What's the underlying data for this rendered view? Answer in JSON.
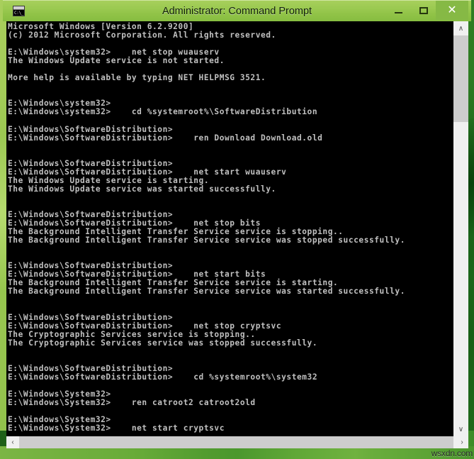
{
  "window": {
    "title": "Administrator: Command Prompt",
    "icon_name": "command-prompt-icon",
    "icon_text": "C:\\_",
    "caption": {
      "minimize_label": "–",
      "maximize_label": "□",
      "close_label": "✕"
    },
    "colors": {
      "titlebar": "#9ac950",
      "close_button": "#86b945",
      "console_background": "#000000",
      "console_foreground": "#c0c0c0",
      "scrollbar_track": "#f0f0f0",
      "scrollbar_thumb": "#cdcdcd"
    }
  },
  "scrollbars": {
    "vertical": {
      "up_arrow": "∧",
      "down_arrow": "∨"
    },
    "horizontal": {
      "left_arrow": "‹",
      "right_arrow": "›"
    }
  },
  "console": {
    "text": "Microsoft Windows [Version 6.2.9200]\n(c) 2012 Microsoft Corporation. All rights reserved.\n\nE:\\Windows\\system32>    net stop wuauserv\nThe Windows Update service is not started.\n\nMore help is available by typing NET HELPMSG 3521.\n\n\nE:\\Windows\\system32>\nE:\\Windows\\system32>    cd %systemroot%\\SoftwareDistribution\n\nE:\\Windows\\SoftwareDistribution>\nE:\\Windows\\SoftwareDistribution>    ren Download Download.old\n\n\nE:\\Windows\\SoftwareDistribution>\nE:\\Windows\\SoftwareDistribution>    net start wuauserv\nThe Windows Update service is starting.\nThe Windows Update service was started successfully.\n\n\nE:\\Windows\\SoftwareDistribution>\nE:\\Windows\\SoftwareDistribution>    net stop bits\nThe Background Intelligent Transfer Service service is stopping..\nThe Background Intelligent Transfer Service service was stopped successfully.\n\n\nE:\\Windows\\SoftwareDistribution>\nE:\\Windows\\SoftwareDistribution>    net start bits\nThe Background Intelligent Transfer Service service is starting.\nThe Background Intelligent Transfer Service service was started successfully.\n\n\nE:\\Windows\\SoftwareDistribution>\nE:\\Windows\\SoftwareDistribution>    net stop cryptsvc\nThe Cryptographic Services service is stopping..\nThe Cryptographic Services service was stopped successfully.\n\n\nE:\\Windows\\SoftwareDistribution>\nE:\\Windows\\SoftwareDistribution>    cd %systemroot%\\system32\n\nE:\\Windows\\System32>\nE:\\Windows\\System32>    ren catroot2 catroot2old\n\nE:\\Windows\\System32>\nE:\\Windows\\System32>    net start cryptsvc"
  },
  "watermark": {
    "text": "wsxdn.com"
  }
}
